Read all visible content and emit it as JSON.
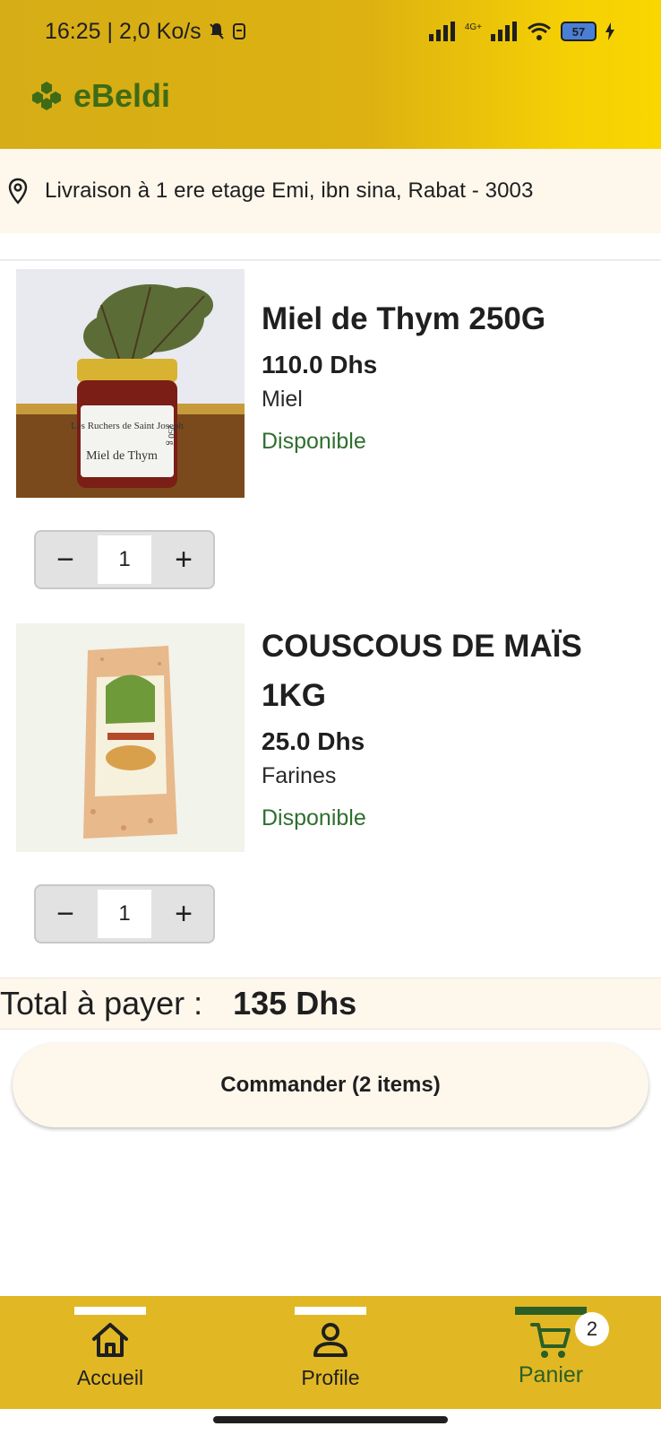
{
  "status_bar": {
    "time_speed": "16:25 | 2,0 Ko/s",
    "network": "4G+",
    "battery": "57"
  },
  "app": {
    "name": "eBeldi"
  },
  "delivery": {
    "text": "Livraison à 1 ere etage Emi, ibn sina, Rabat - 3003"
  },
  "products": [
    {
      "name": "Miel de Thym 250G",
      "price": "110.0 Dhs",
      "category": "Miel",
      "availability": "Disponible",
      "quantity": "1",
      "image_text": [
        "Les Ruchers de Saint Joseph",
        "Miel de Thym",
        "250 g"
      ]
    },
    {
      "name": "COUSCOUS DE MAÏS 1KG",
      "price": "25.0 Dhs",
      "category": "Farines",
      "availability": "Disponible",
      "quantity": "1"
    }
  ],
  "stepper": {
    "minus": "−",
    "plus": "+"
  },
  "total": {
    "label": "Total à payer :",
    "value": "135 Dhs"
  },
  "order_button": "Commander (2 items)",
  "nav": {
    "items": [
      {
        "label": "Accueil",
        "icon": "home-icon"
      },
      {
        "label": "Profile",
        "icon": "person-icon"
      },
      {
        "label": "Panier",
        "icon": "cart-icon",
        "badge": "2"
      }
    ]
  },
  "colors": {
    "header": "#dcb111",
    "accent_green": "#3f6b16",
    "nav_bg": "#e1b824",
    "cream": "#fdf7ec"
  }
}
